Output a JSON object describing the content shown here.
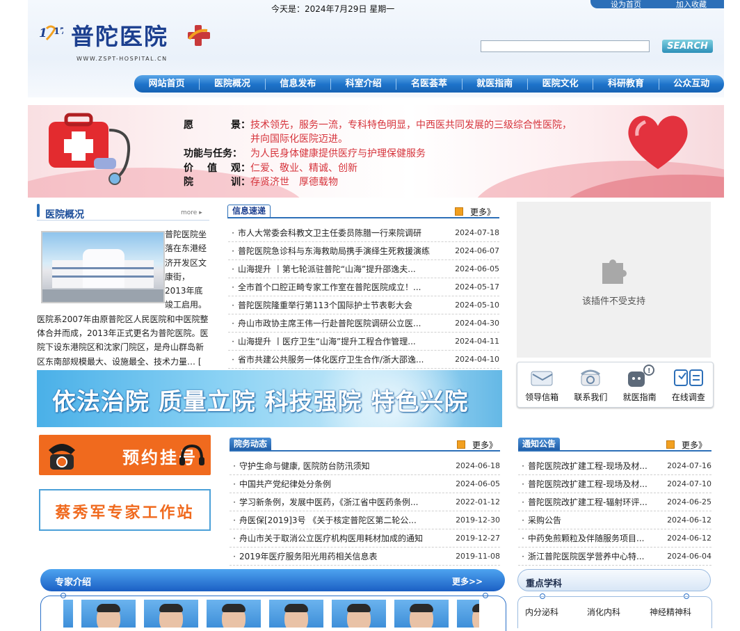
{
  "header": {
    "date_text": "今天是：2024年7月29日  星期一",
    "top_links": [
      "设为首页",
      "加入收藏"
    ],
    "logo_mark": "1917",
    "logo_text": "普陀医院",
    "logo_url": "WWW.ZSPT-HOSPITAL.CN",
    "search_button": "SEARCH"
  },
  "nav": [
    "网站首页",
    "医院概况",
    "信息发布",
    "科室介绍",
    "名医荟萃",
    "就医指南",
    "医院文化",
    "科研教育",
    "公众互动"
  ],
  "banner": {
    "rows": [
      {
        "key": [
          "愿",
          "景："
        ],
        "val": [
          "技术领先，服务一流，专科特色明显，中西医共同发展的三级综合性医院，",
          "并向国际化医院迈进。"
        ]
      },
      {
        "key": [
          "功能与任务："
        ],
        "val": [
          "为人民身体健康提供医疗与护理保健服务"
        ]
      },
      {
        "key": [
          "价",
          "值",
          "观："
        ],
        "val": [
          "仁爱、敬业、精诚、创新"
        ]
      },
      {
        "key": [
          "院",
          "训："
        ],
        "val": [
          "存贤济世　厚德载物"
        ]
      }
    ]
  },
  "about": {
    "title": "医院概况",
    "more": "more",
    "text": "普陀医院坐落在东港经济开发区文康街，2013年底竣工启用。医院系2007年由原普陀区人民医院和中医院整体合并而成，2013年正式更名为普陀医院。医院下设东港院区和沈家门院区，是舟山群岛新区东南部规模最大、设施最全、技术力量…",
    "detail": "[ 详细 ]"
  },
  "news": {
    "title": "信息速递",
    "more": "更多》",
    "items": [
      {
        "t": "市人大常委会科教文卫主任委员陈腊一行来院调研",
        "d": "2024-07-18"
      },
      {
        "t": "普陀医院急诊科与东海救助局携手演绎生死救援演练",
        "d": "2024-06-07"
      },
      {
        "t": "山海提升 丨第七轮派驻普陀“山海”提升邵逸夫...",
        "d": "2024-06-05"
      },
      {
        "t": "全市首个口腔正畸专家工作室在普陀医院成立！...",
        "d": "2024-05-17"
      },
      {
        "t": "普陀医院隆重举行第113个国际护士节表彰大会",
        "d": "2024-05-10"
      },
      {
        "t": "舟山市政协主席王伟一行赴普陀医院调研公立医...",
        "d": "2024-04-30"
      },
      {
        "t": "山海提升 丨医疗卫生“山海”提升工程合作管理...",
        "d": "2024-04-11"
      },
      {
        "t": "省市共建公共服务一体化医疗卫生合作/浙大邵逸...",
        "d": "2024-04-10"
      }
    ]
  },
  "plugin": {
    "text": "该插件不受支持"
  },
  "quick_links": [
    "领导信箱",
    "联系我们",
    "就医指南",
    "在线调查"
  ],
  "slogan": "依法治院 质量立院 科技强院 特色兴院",
  "booking": "预约挂号",
  "expert_studio": "蔡秀军专家工作站",
  "affairs": {
    "title": "院务动态",
    "more": "更多》",
    "items": [
      {
        "t": "守护生命与健康, 医院防台防汛须知",
        "d": "2024-06-18"
      },
      {
        "t": "中国共产党纪律处分条例",
        "d": "2024-06-05"
      },
      {
        "t": "学习新条例，发展中医药，《浙江省中医药条例...",
        "d": "2022-01-12"
      },
      {
        "t": "舟医保[2019]3号 《关于核定普陀区第二轮公...",
        "d": "2019-12-30"
      },
      {
        "t": "舟山市关于取消公立医疗机构医用耗材加成的通知",
        "d": "2019-12-27"
      },
      {
        "t": "2019年医疗服务阳光用药相关信息表",
        "d": "2019-11-08"
      }
    ]
  },
  "notices": {
    "title": "通知公告",
    "more": "更多》",
    "items": [
      {
        "t": "普陀医院改扩建工程-现场及材...",
        "d": "2024-07-16"
      },
      {
        "t": "普陀医院改扩建工程-现场及材...",
        "d": "2024-07-10"
      },
      {
        "t": "普陀医院改扩建工程-辐射环评...",
        "d": "2024-06-25"
      },
      {
        "t": "采购公告",
        "d": "2024-06-12"
      },
      {
        "t": "中药免煎颗粒及伴随服务项目...",
        "d": "2024-06-12"
      },
      {
        "t": "浙江普陀医院医学营养中心特...",
        "d": "2024-06-04"
      }
    ]
  },
  "experts": {
    "title": "专家介绍",
    "more": "更多>>"
  },
  "key_disciplines": {
    "title": "重点学科",
    "items": [
      "内分泌科",
      "消化内科",
      "神经精神科"
    ]
  },
  "colors": {
    "brand_blue": "#1c3f8f",
    "nav_blue": "#1d72c9",
    "banner_red": "#d6343c",
    "booking_orange": "#f06a1e"
  }
}
